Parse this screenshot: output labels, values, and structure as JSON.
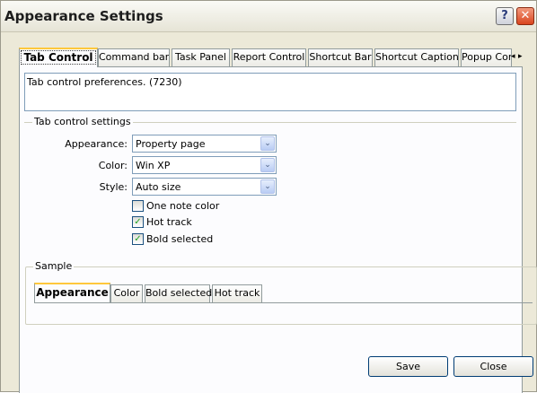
{
  "window": {
    "title": "Appearance Settings"
  },
  "titlebar": {
    "help": "?",
    "close": "✕"
  },
  "tabs": [
    {
      "label": "Tab Control"
    },
    {
      "label": "Command bars"
    },
    {
      "label": "Task Panel"
    },
    {
      "label": "Report Control"
    },
    {
      "label": "Shortcut Bar"
    },
    {
      "label": "Shortcut Caption"
    },
    {
      "label": "Popup Cor"
    }
  ],
  "tab_scroll": {
    "left": "◂",
    "right": "▸"
  },
  "description": "Tab control preferences. (7230)",
  "settings_group": {
    "title": "Tab control settings",
    "appearance_label": "Appearance:",
    "appearance_value": "Property page",
    "color_label": "Color:",
    "color_value": "Win XP",
    "style_label": "Style:",
    "style_value": "Auto size",
    "dropdown_arrow": "⌄",
    "checkboxes": [
      {
        "label": "One note color",
        "checked": false,
        "mark": ""
      },
      {
        "label": "Hot track",
        "checked": true,
        "mark": "✓"
      },
      {
        "label": "Bold selected",
        "checked": true,
        "mark": "✓"
      }
    ]
  },
  "sample_group": {
    "title": "Sample",
    "tabs": [
      {
        "label": "Appearance"
      },
      {
        "label": "Color"
      },
      {
        "label": "Bold selected"
      },
      {
        "label": "Hot track"
      }
    ]
  },
  "buttons": {
    "save": "Save",
    "close": "Close"
  },
  "colors": {
    "accent_tab": "#ffc83c",
    "check_mark": "#21a121",
    "close_button": "#d9441e"
  }
}
